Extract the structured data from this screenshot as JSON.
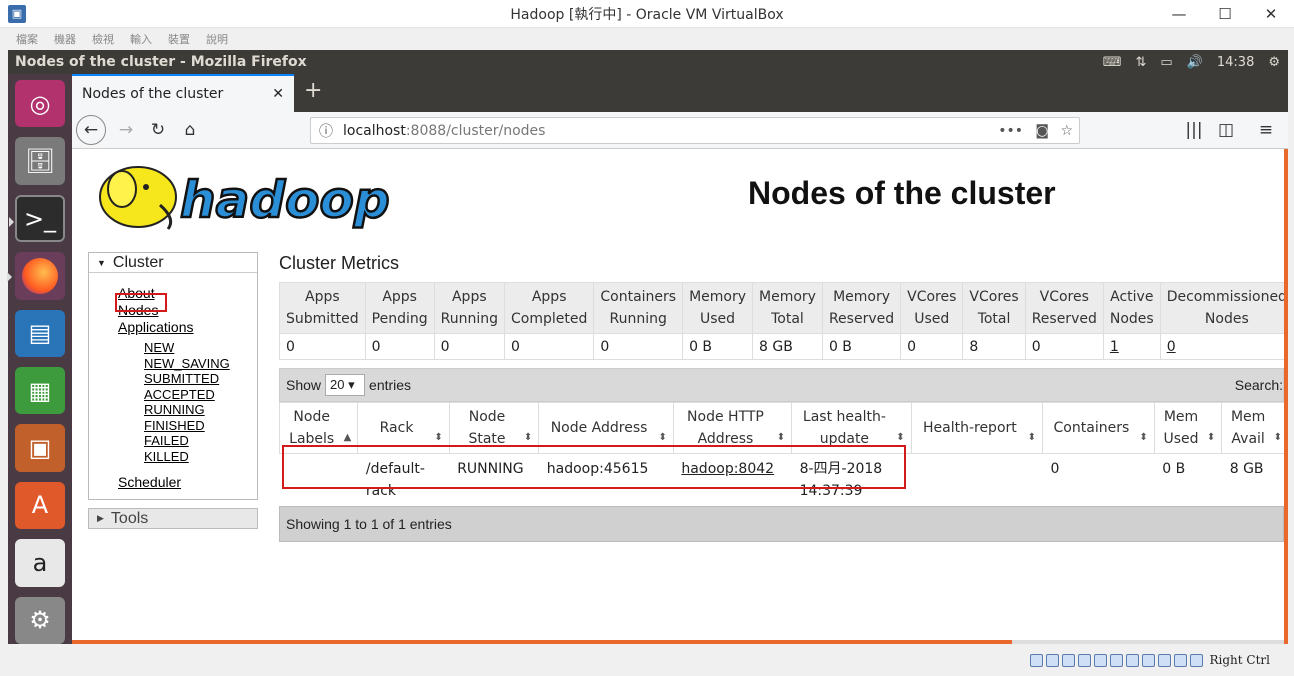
{
  "vbox": {
    "title": "Hadoop [執行中] - Oracle VM VirtualBox",
    "menu": [
      "檔案",
      "機器",
      "檢視",
      "輸入",
      "裝置",
      "說明"
    ],
    "host_key": "Right Ctrl"
  },
  "ubuntu": {
    "window_title": "Nodes of the cluster - Mozilla Firefox",
    "clock": "14:38"
  },
  "browser": {
    "tab_title": "Nodes of the cluster",
    "url_host": "localhost",
    "url_rest": ":8088/cluster/nodes"
  },
  "page": {
    "heading": "Nodes of the cluster",
    "sidebar": {
      "cluster_label": "Cluster",
      "links": [
        "About",
        "Nodes",
        "Applications"
      ],
      "app_states": [
        "NEW",
        "NEW_SAVING",
        "SUBMITTED",
        "ACCEPTED",
        "RUNNING",
        "FINISHED",
        "FAILED",
        "KILLED"
      ],
      "scheduler": "Scheduler",
      "tools_label": "Tools"
    },
    "metrics": {
      "title": "Cluster Metrics",
      "headers": [
        [
          "Apps",
          "Submitted"
        ],
        [
          "Apps",
          "Pending"
        ],
        [
          "Apps",
          "Running"
        ],
        [
          "Apps",
          "Completed"
        ],
        [
          "Containers",
          "Running"
        ],
        [
          "Memory",
          "Used"
        ],
        [
          "Memory",
          "Total"
        ],
        [
          "Memory",
          "Reserved"
        ],
        [
          "VCores",
          "Used"
        ],
        [
          "VCores",
          "Total"
        ],
        [
          "VCores",
          "Reserved"
        ],
        [
          "Active",
          "Nodes"
        ],
        [
          "Decommissioned",
          "Nodes"
        ]
      ],
      "values": [
        "0",
        "0",
        "0",
        "0",
        "0",
        "0 B",
        "8 GB",
        "0 B",
        "0",
        "8",
        "0",
        "1",
        "0"
      ]
    },
    "table": {
      "show_label": "Show",
      "entries_value": "20",
      "entries_label": "entries",
      "search_label": "Search:",
      "headers": [
        [
          "Node",
          "Labels"
        ],
        [
          "Rack",
          ""
        ],
        [
          "Node",
          "State"
        ],
        [
          "Node Address",
          ""
        ],
        [
          "Node HTTP",
          "Address"
        ],
        [
          "Last health-",
          "update"
        ],
        [
          "Health-report",
          ""
        ],
        [
          "Containers",
          ""
        ],
        [
          "Mem",
          "Used"
        ],
        [
          "Mem",
          "Avail"
        ]
      ],
      "row": {
        "labels": "",
        "rack": "/default-rack",
        "state": "RUNNING",
        "address": "hadoop:45615",
        "http": "hadoop:8042",
        "last_health": "8-四月-2018 14:37:39",
        "health_report": "",
        "containers": "0",
        "mem_used": "0 B",
        "mem_avail": "8 GB"
      },
      "footer": "Showing 1 to 1 of 1 entries"
    }
  }
}
